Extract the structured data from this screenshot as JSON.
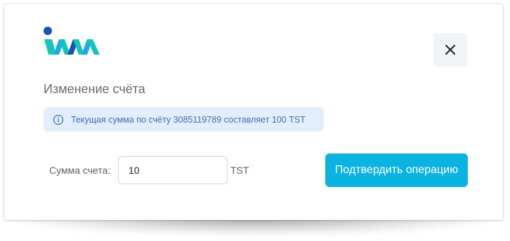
{
  "modal": {
    "title": "Изменение счёта",
    "info_text": "Текущая сумма по счёту 3085119789 составляет 100 TST",
    "amount_label": "Сумма счета:",
    "amount_value": "10",
    "currency": "TST",
    "confirm_label": "Подтвердить операцию"
  },
  "icons": {
    "logo": "logo-icon",
    "close": "close-icon",
    "info": "info-circle-icon"
  },
  "colors": {
    "accent": "#0bb3e3",
    "info_bg": "#e3eefc",
    "info_text": "#3f6fb6",
    "close_bg": "#f2f3f7",
    "logo_dark_blue": "#1a4fb8",
    "logo_teal": "#12c7b8",
    "logo_light_blue": "#22a8e8"
  }
}
